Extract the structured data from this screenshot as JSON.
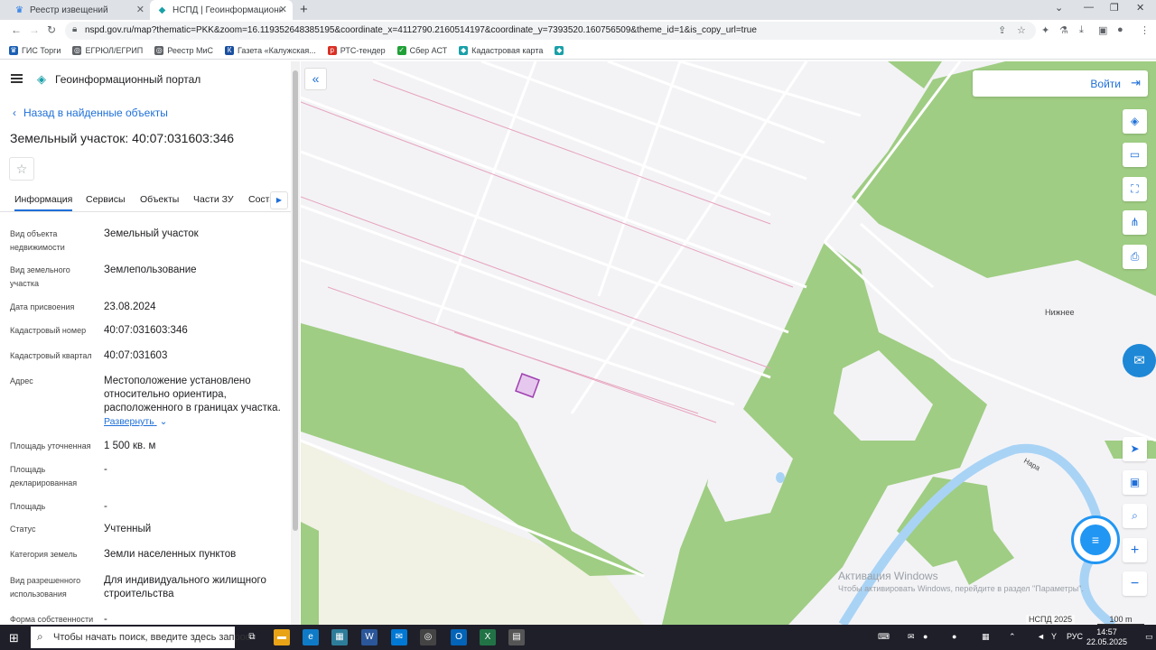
{
  "browser": {
    "tabs": [
      {
        "title": "Реестр извещений",
        "active": false
      },
      {
        "title": "НСПД | Геоинформационный п",
        "active": true
      }
    ],
    "url": "nspd.gov.ru/map?thematic=PKK&zoom=16.119352648385195&coordinate_x=4112790.2160514197&coordinate_y=7393520.160756509&theme_id=1&is_copy_url=true",
    "bookmarks": [
      {
        "label": "ГИС Торги",
        "color": "#1a5fb4"
      },
      {
        "label": "ЕГРЮЛ/ЕГРИП",
        "color": "#5f6368"
      },
      {
        "label": "Реестр МиС",
        "color": "#5f6368"
      },
      {
        "label": "Газета «Калужская...",
        "color": "#1a4fa0"
      },
      {
        "label": "РТС-тендер",
        "color": "#d93025"
      },
      {
        "label": "Сбер АСТ",
        "color": "#21a038"
      },
      {
        "label": "Кадастровая карта",
        "color": "#1aa0a8"
      },
      {
        "label": "",
        "color": "#1aa0a8"
      }
    ]
  },
  "panel": {
    "portal_title": "Геоинформационный портал",
    "back_link": "Назад в найденные объекты",
    "object_title": "Земельный участок: 40:07:031603:346",
    "tabs": [
      "Информация",
      "Сервисы",
      "Объекты",
      "Части ЗУ",
      "Соста"
    ],
    "fields": [
      {
        "key": "Вид объекта недвижимости",
        "value": "Земельный участок"
      },
      {
        "key": "Вид земельного участка",
        "value": "Землепользование"
      },
      {
        "key": "Дата присвоения",
        "value": "23.08.2024"
      },
      {
        "key": "Кадастровый номер",
        "value": "40:07:031603:346"
      },
      {
        "key": "Кадастровый квартал",
        "value": "40:07:031603"
      },
      {
        "key": "Адрес",
        "value": "Местоположение установлено относительно ориентира, расположенного в границах участка."
      },
      {
        "key": "Площадь уточненная",
        "value": "1 500 кв. м"
      },
      {
        "key": "Площадь декларированная",
        "value": "-"
      },
      {
        "key": "Площадь",
        "value": "-"
      },
      {
        "key": "Статус",
        "value": "Учтенный"
      },
      {
        "key": "Категория земель",
        "value": "Земли населенных пунктов"
      },
      {
        "key": "Вид разрешенного использования",
        "value": "Для индивидуального жилищного строительства"
      },
      {
        "key": "Форма собственности",
        "value": "-"
      }
    ],
    "expand_link": "Развернуть"
  },
  "map": {
    "login_label": "Войти",
    "labels": {
      "village": "Нижнее",
      "river": "Нара"
    },
    "activation_title": "Активация Windows",
    "activation_text": "Чтобы активировать Windows, перейдите в раздел \"Параметры\".",
    "copyright": "НСПД 2025",
    "scale_label": "100 m",
    "colors": {
      "forest": "#9fcd83",
      "parcel_fill": "#e6c8ee",
      "parcel_stroke": "#a040b0",
      "water": "#a9d3f5"
    }
  },
  "taskbar": {
    "search_placeholder": "Чтобы начать поиск, введите здесь запрос",
    "language": "РУС",
    "time": "14:57",
    "date": "22.05.2025"
  }
}
